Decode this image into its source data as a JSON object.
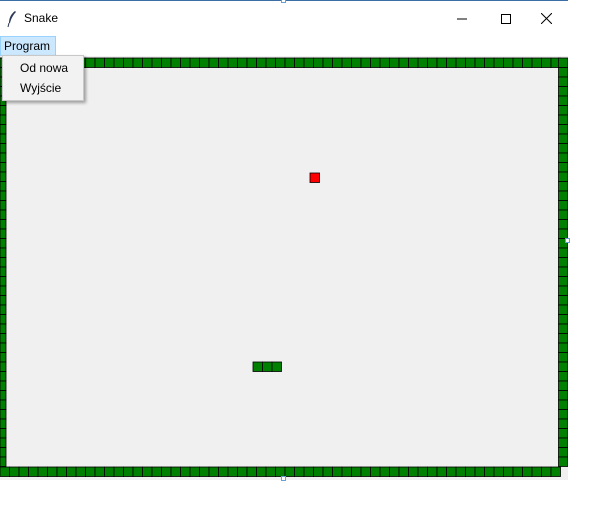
{
  "window": {
    "title": "Snake",
    "controls": {
      "minimize_icon": "minimize-icon",
      "maximize_icon": "maximize-icon",
      "close_icon": "close-icon"
    }
  },
  "menubar": {
    "program_label": "Program"
  },
  "dropdown": {
    "items": [
      {
        "label": "Od nowa"
      },
      {
        "label": "Wyjście"
      }
    ]
  },
  "game": {
    "colors": {
      "wall": "#008000",
      "wall_outline": "#000000",
      "snake": "#008000",
      "food": "#ff0000",
      "background": "#f0f0f0"
    },
    "snake_length": 3
  }
}
